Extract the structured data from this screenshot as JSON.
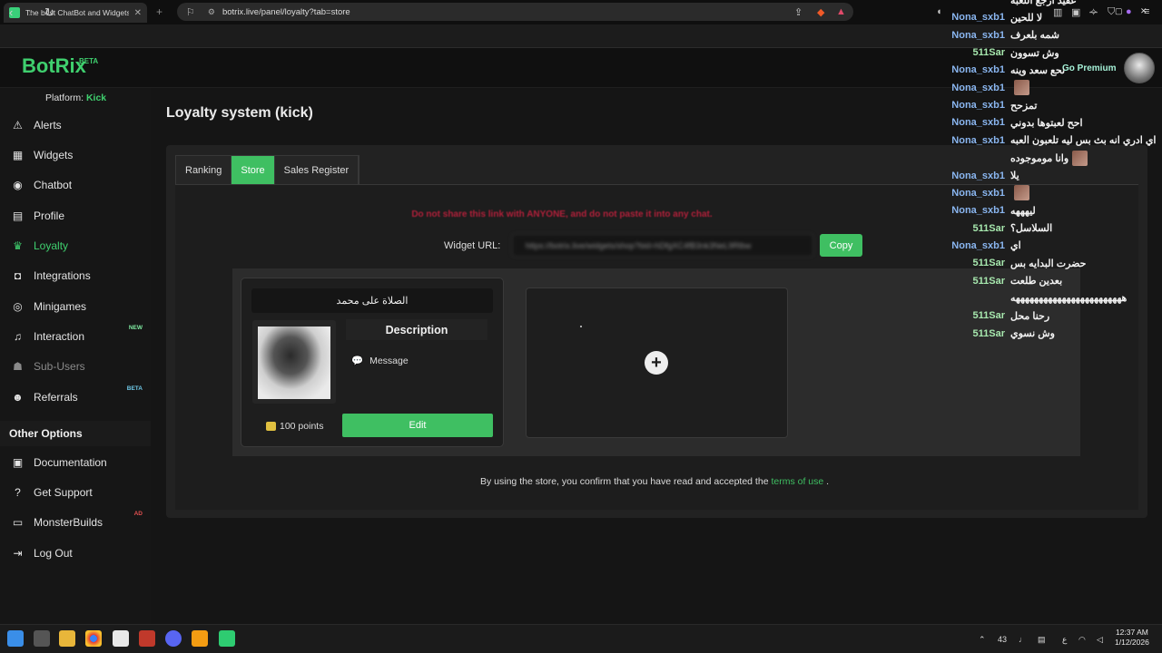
{
  "browser": {
    "tab_title": "The best ChatBot and Widgets f",
    "tab_close": "✕",
    "new_tab": "+",
    "url": "botrix.live/panel/loyalty?tab=store",
    "window_controls": [
      "—",
      "▢",
      "✕"
    ]
  },
  "app": {
    "logo": "BotRix",
    "logo_badge": "BETA",
    "premium": "Go Premium",
    "platform_label": "Platform:",
    "platform_value": "Kick"
  },
  "sidebar": {
    "items": [
      {
        "label": "Alerts",
        "icon": "warning-icon",
        "glyph": "⚠"
      },
      {
        "label": "Widgets",
        "icon": "grid-icon",
        "glyph": "▦"
      },
      {
        "label": "Chatbot",
        "icon": "robot-icon",
        "glyph": "◉"
      },
      {
        "label": "Profile",
        "icon": "id-card-icon",
        "glyph": "▤"
      },
      {
        "label": "Loyalty",
        "icon": "trophy-icon",
        "glyph": "♛"
      },
      {
        "label": "Integrations",
        "icon": "plug-icon",
        "glyph": "◘"
      },
      {
        "label": "Minigames",
        "icon": "gamepad-icon",
        "glyph": "◎"
      },
      {
        "label": "Interaction",
        "icon": "music-icon",
        "glyph": "♫",
        "badge": "NEW"
      },
      {
        "label": "Sub-Users",
        "icon": "users-icon",
        "glyph": "☗"
      },
      {
        "label": "Referrals",
        "icon": "people-icon",
        "glyph": "☻",
        "badge": "BETA"
      }
    ],
    "other_options": "Other Options",
    "other_items": [
      {
        "label": "Documentation",
        "icon": "docs-icon",
        "glyph": "▣"
      },
      {
        "label": "Get Support",
        "icon": "question-icon",
        "glyph": "?"
      },
      {
        "label": "MonsterBuilds",
        "icon": "monitor-icon",
        "glyph": "▭",
        "badge": "AD"
      },
      {
        "label": "Log Out",
        "icon": "logout-icon",
        "glyph": "⇥"
      }
    ]
  },
  "main": {
    "title": "Loyalty system (kick)",
    "tabs": [
      "Ranking",
      "Store",
      "Sales Register"
    ],
    "warning": "Do not share this link with ANYONE, and do not paste it into any chat.",
    "widget_url_label": "Widget URL:",
    "widget_url_value": "https://botrix.live/widgets/shop?bid=hDfgXC4fB3nk3NeL9Rlbw",
    "copy_label": "Copy",
    "card": {
      "title": "الصلاة على محمد",
      "description_heading": "Description",
      "message": "Message",
      "points": "100 points",
      "edit_label": "Edit"
    },
    "add_label": "+",
    "terms_prefix": "By using the store, you confirm that you have read and accepted the",
    "terms_link": "terms of use",
    "terms_suffix": "."
  },
  "chat": [
    {
      "user": "",
      "msg": "عقيد ارجع اللعبة",
      "emote": false
    },
    {
      "user": "Nona_sxb1",
      "msg": "لا للحين",
      "emote": false
    },
    {
      "user": "Nona_sxb1",
      "msg": "شمه بلعرف",
      "emote": false
    },
    {
      "user": "511Sar",
      "msg": "وش تسوون",
      "emote": false
    },
    {
      "user": "Nona_sxb1",
      "msg": "نحع سعد وينه",
      "emote": false
    },
    {
      "user": "Nona_sxb1",
      "msg": "",
      "emote": true
    },
    {
      "user": "Nona_sxb1",
      "msg": "تمزحح",
      "emote": false
    },
    {
      "user": "Nona_sxb1",
      "msg": "احح لعبتوها بدوني",
      "emote": false
    },
    {
      "user": "Nona_sxb1",
      "msg": "اي ادري انه بث بس ليه تلعبون العبه",
      "emote": false
    },
    {
      "user": "",
      "msg": "وانا موموجوده",
      "emote": true
    },
    {
      "user": "Nona_sxb1",
      "msg": "يلا",
      "emote": false
    },
    {
      "user": "Nona_sxb1",
      "msg": "",
      "emote": true
    },
    {
      "user": "Nona_sxb1",
      "msg": "ليهههه",
      "emote": false
    },
    {
      "user": "511Sar",
      "msg": "السلاسل؟",
      "emote": false
    },
    {
      "user": "Nona_sxb1",
      "msg": "اي",
      "emote": false
    },
    {
      "user": "511Sar",
      "msg": "حضرت البدايه بس",
      "emote": false
    },
    {
      "user": "511Sar",
      "msg": "بعدين طلعت",
      "emote": false
    },
    {
      "user": "",
      "msg": "ههههههههههههههههههههههههه",
      "emote": false
    },
    {
      "user": "511Sar",
      "msg": "رحنا محل",
      "emote": false
    },
    {
      "user": "511Sar",
      "msg": "وش نسوي",
      "emote": false
    }
  ],
  "taskbar": {
    "tray_count": "43",
    "lang": "ع",
    "time": "12:37 AM",
    "date": "1/12/2026"
  },
  "colors": {
    "accent": "#3fbf62",
    "warning": "#b0203a",
    "chat_user_blue": "#8ab6f0",
    "chat_user_green": "#a7e8ae"
  }
}
